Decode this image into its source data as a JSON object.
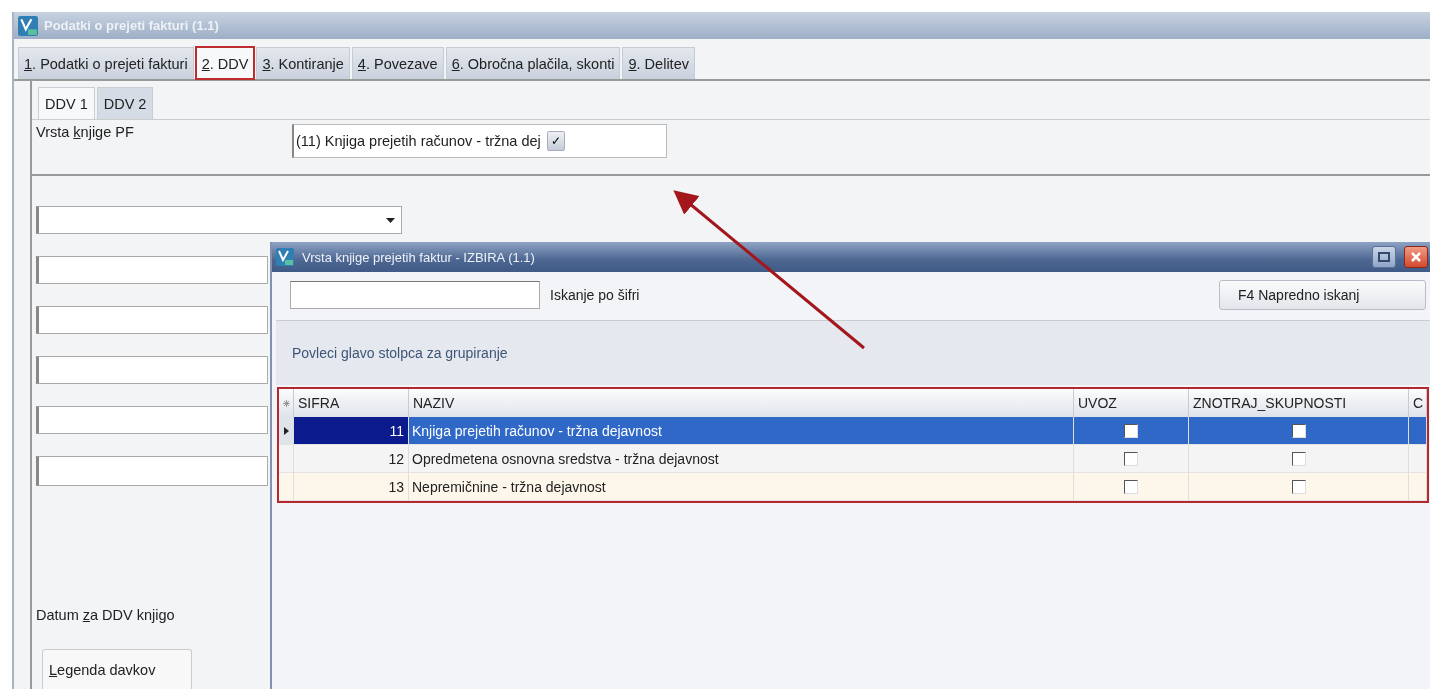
{
  "window": {
    "title": "Podatki o prejeti fakturi  (1.1)"
  },
  "tabs": [
    {
      "key": "1",
      "label": ". Podatki o prejeti fakturi",
      "selected": false
    },
    {
      "key": "2",
      "label": ". DDV",
      "selected": true
    },
    {
      "key": "3",
      "label": ". Kontiranje",
      "selected": false
    },
    {
      "key": "4",
      "label": ". Povezave",
      "selected": false
    },
    {
      "key": "6",
      "label": ". Obročna plačila, skonti",
      "selected": false
    },
    {
      "key": "9",
      "label": ". Delitev",
      "selected": false
    }
  ],
  "subtabs": [
    {
      "label": "DDV 1",
      "selected": true
    },
    {
      "label": "DDV 2",
      "selected": false
    }
  ],
  "book_field": {
    "label_before": "Vrsta ",
    "label_key": "k",
    "label_after": "njige PF",
    "value": "(11) Knjiga prejetih računov - tržna dej",
    "button": "✓"
  },
  "date_label": {
    "before": "Datum ",
    "key": "z",
    "after": "a DDV knjigo"
  },
  "legend_tab": {
    "key": "L",
    "rest": "egenda davkov"
  },
  "dialog": {
    "title": "Vrsta knjige prejetih faktur - IZBIRA  (1.1)",
    "search_label": "Iskanje po šifri",
    "advanced_button": "F4  Napredno iskanj",
    "group_hint": "Povleci glavo stolpca za grupiranje",
    "table": {
      "columns": [
        "SIFRA",
        "NAZIV",
        "UVOZ",
        "ZNOTRAJ_SKUPNOSTI",
        "C"
      ],
      "rows": [
        {
          "sifra": "11",
          "naziv": "Knjiga prejetih računov - tržna dejavnost",
          "uvoz": false,
          "znotraj": false,
          "selected": true
        },
        {
          "sifra": "12",
          "naziv": "Opredmetena osnovna sredstva - tržna dejavnost",
          "uvoz": false,
          "znotraj": false,
          "selected": false
        },
        {
          "sifra": "13",
          "naziv": "Nepremičnine - tržna dejavnost",
          "uvoz": false,
          "znotraj": false,
          "selected": false
        }
      ]
    }
  }
}
